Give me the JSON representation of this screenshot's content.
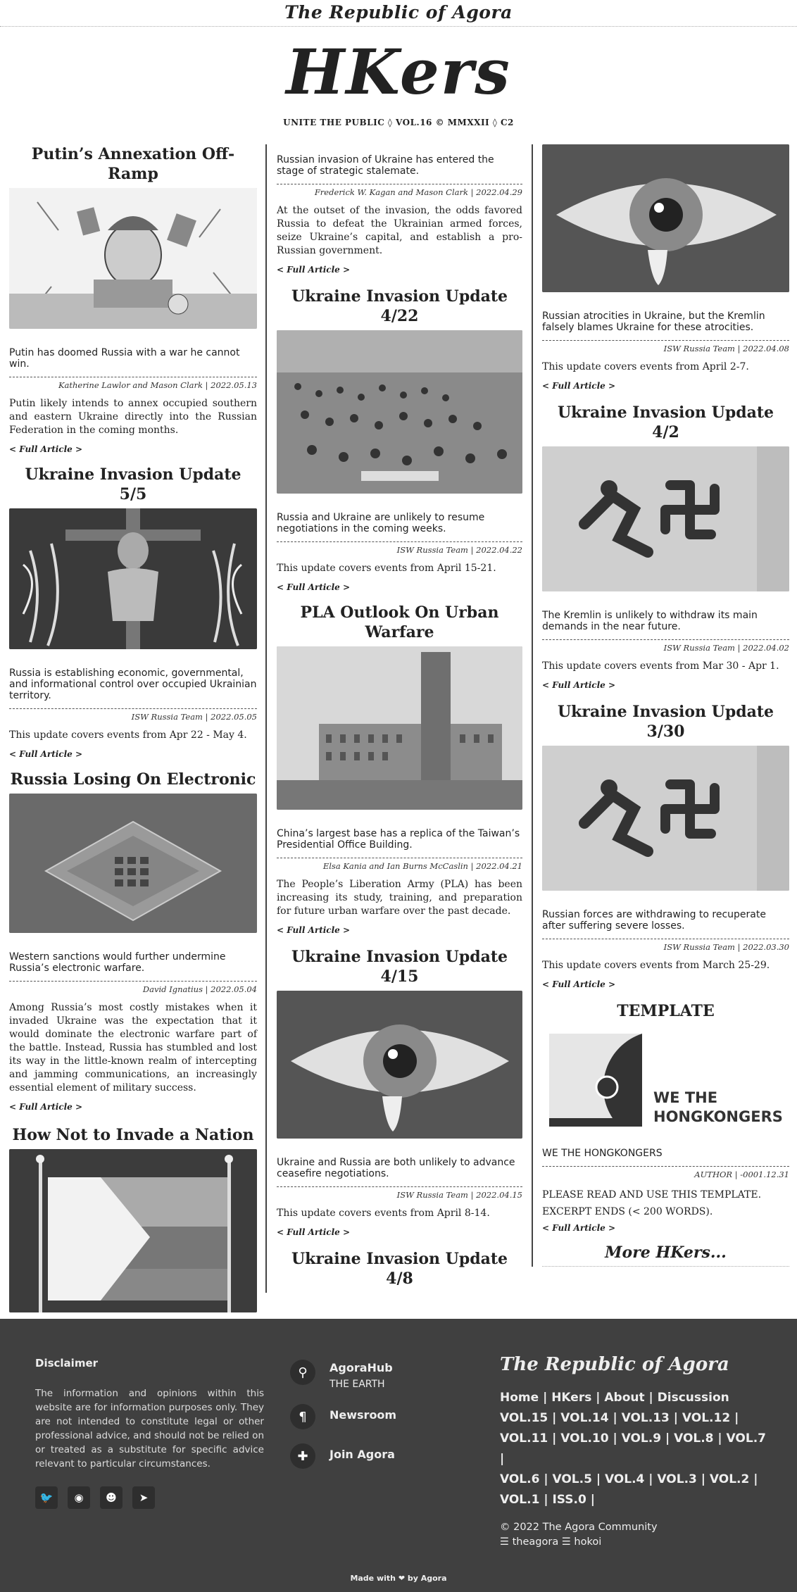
{
  "site": {
    "top_brand": "The Republic of Agora",
    "logo": "HKers",
    "motto": "UNITE THE PUBLIC ◊ VOL.16 © MMXXII ◊ C2",
    "more_link": "More HKers..."
  },
  "col1": [
    {
      "title": "Putin’s Annexation Off-Ramp",
      "lede": "Putin has doomed Russia with a war he cannot win.",
      "byline": "Katherine Lawlor and Mason Clark | 2022.05.13",
      "body": "Putin likely intends to annex occupied southern and eastern Ukraine directly into the Russian Federation in the coming months.",
      "more": "< Full Article >"
    },
    {
      "title": "Ukraine Invasion Update 5/5",
      "lede": "Russia is establishing economic, governmental, and informational control over occupied Ukrainian territory.",
      "byline": "ISW Russia Team | 2022.05.05",
      "body": "This update covers events from Apr 22 - May 4.",
      "more": "< Full Article >"
    },
    {
      "title": "Russia Losing On Electronic",
      "lede": "Western sanctions would further undermine Russia’s electronic warfare.",
      "byline": "David Ignatius | 2022.05.04",
      "body": "Among Russia’s most costly mistakes when it invaded Ukraine was the expectation that it would dominate the electronic warfare part of the battle. Instead, Russia has stumbled and lost its way in the little-known realm of intercepting and jamming communications, an increasingly essential element of military success.",
      "more": "< Full Article >"
    },
    {
      "title": "How Not to Invade a Nation"
    }
  ],
  "col2": [
    {
      "lede": "Russian invasion of Ukraine has entered the stage of strategic stalemate.",
      "byline": "Frederick W. Kagan and Mason Clark | 2022.04.29",
      "body": "At the outset of the invasion, the odds favored Russia to defeat the Ukrainian armed forces, seize Ukraine’s capital, and establish a pro-Russian government.",
      "more": "< Full Article >"
    },
    {
      "title": "Ukraine Invasion Update 4/22",
      "lede": "Russia and Ukraine are unlikely to resume negotiations in the coming weeks.",
      "byline": "ISW Russia Team | 2022.04.22",
      "body": "This update covers events from April 15-21.",
      "more": "< Full Article >"
    },
    {
      "title": "PLA Outlook On Urban Warfare",
      "lede": "China’s largest base has a replica of the Taiwan’s Presidential Office Building.",
      "byline": "Elsa Kania and Ian Burns McCaslin | 2022.04.21",
      "body": "The People’s Liberation Army (PLA) has been increasing its study, training, and preparation for future urban warfare over the past decade.",
      "more": "< Full Article >"
    },
    {
      "title": "Ukraine Invasion Update 4/15",
      "lede": "Ukraine and Russia are both unlikely to advance ceasefire negotiations.",
      "byline": "ISW Russia Team | 2022.04.15",
      "body": "This update covers events from April 8-14.",
      "more": "< Full Article >"
    },
    {
      "title": "Ukraine Invasion Update 4/8"
    }
  ],
  "col3": [
    {
      "lede": "Russian atrocities in Ukraine, but the Kremlin falsely blames Ukraine for these atrocities.",
      "byline": "ISW Russia Team | 2022.04.08",
      "body": "This update covers events from April 2-7.",
      "more": "< Full Article >"
    },
    {
      "title": "Ukraine Invasion Update 4/2",
      "lede": "The Kremlin is unlikely to withdraw its main demands in the near future.",
      "byline": "ISW Russia Team | 2022.04.02",
      "body": "This update covers events from Mar 30 - Apr 1.",
      "more": "< Full Article >"
    },
    {
      "title": "Ukraine Invasion Update 3/30",
      "lede": "Russian forces are withdrawing to recuperate after suffering severe losses.",
      "byline": "ISW Russia Team | 2022.03.30",
      "body": "This update covers events from March 25-29.",
      "more": "< Full Article >"
    },
    {
      "title": "TEMPLATE",
      "logo_line1": "WE THE",
      "logo_line2": "HONGKONGERS",
      "lede": "WE THE HONGKONGERS",
      "byline": "AUTHOR | -0001.12.31",
      "body": "PLEASE READ AND USE THIS TEMPLATE. EXCERPT ENDS (< 200 WORDS).",
      "more": "< Full Article >"
    }
  ],
  "footer": {
    "disclaimer_title": "Disclaimer",
    "disclaimer_text": "The information and opinions within this website are for information purposes only. They are not intended to constitute legal or other professional advice, and should not be relied on or treated as a substitute for specific advice relevant to particular circumstances.",
    "hub_title": "AgoraHub",
    "hub_sub": "THE EARTH",
    "newsroom": "Newsroom",
    "join": "Join Agora",
    "brand": "The Republic of Agora",
    "nav_line1": "Home | HKers | About | Discussion",
    "nav_line2": "VOL.15 | VOL.14 | VOL.13 | VOL.12 |",
    "nav_line3": "VOL.11 | VOL.10 | VOL.9 | VOL.8 | VOL.7 |",
    "nav_line4": "VOL.6 | VOL.5 | VOL.4 | VOL.3 | VOL.2 |",
    "nav_line5": "VOL.1 | ISS.0 |",
    "copyright": "© 2022 The Agora Community",
    "handles": "☰ theagora ☰ hokoi",
    "madewith": "Made with ❤ by Agora"
  },
  "colors": {
    "footer_bg": "#404040",
    "rule": "#444444"
  },
  "icons": [
    "twitter-icon",
    "github-icon",
    "reddit-icon",
    "telegram-icon",
    "map-pin-icon",
    "pilcrow-icon",
    "puzzle-icon"
  ]
}
